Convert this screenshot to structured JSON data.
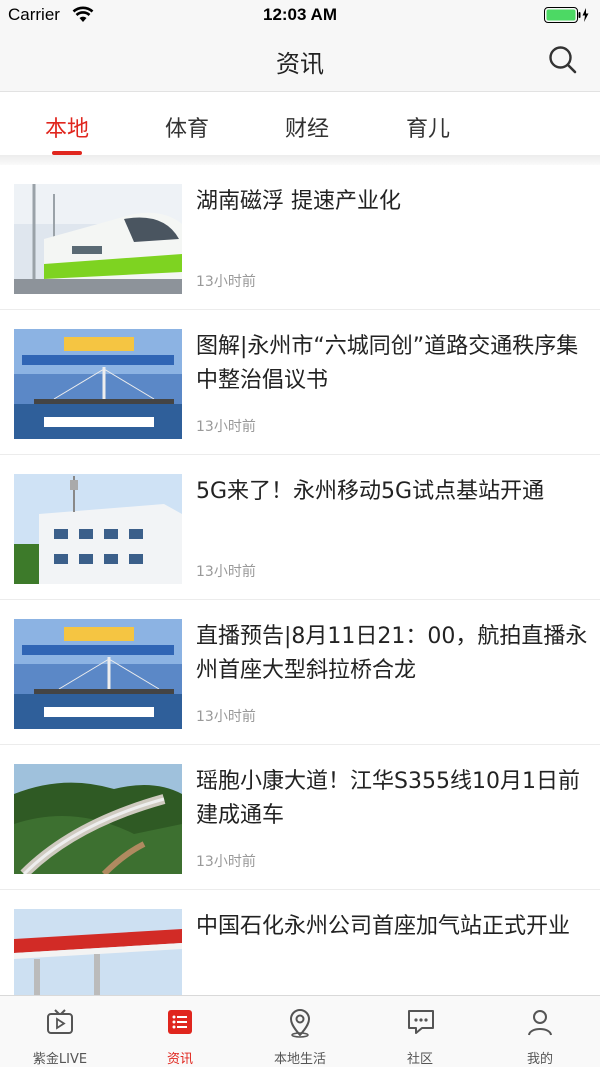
{
  "status_bar": {
    "carrier": "Carrier",
    "time": "12:03 AM"
  },
  "nav": {
    "title": "资讯"
  },
  "tabs": [
    {
      "label": "本地",
      "active": true
    },
    {
      "label": "体育",
      "active": false
    },
    {
      "label": "财经",
      "active": false
    },
    {
      "label": "育儿",
      "active": false
    }
  ],
  "news": [
    {
      "title": "湖南磁浮 提速产业化",
      "time": "13小时前"
    },
    {
      "title": "图解|永州市“六城同创”道路交通秩序集中整治倡议书",
      "time": "13小时前"
    },
    {
      "title": "5G来了！永州移动5G试点基站开通",
      "time": "13小时前"
    },
    {
      "title": "直播预告|8月11日21：00，航拍直播永州首座大型斜拉桥合龙",
      "time": "13小时前"
    },
    {
      "title": "瑶胞小康大道！江华S355线10月1日前建成通车",
      "time": "13小时前"
    },
    {
      "title": "中国石化永州公司首座加气站正式开业",
      "time": ""
    }
  ],
  "tab_bar": [
    {
      "label": "紫金LIVE",
      "icon": "tv-icon",
      "active": false
    },
    {
      "label": "资讯",
      "icon": "news-icon",
      "active": true
    },
    {
      "label": "本地生活",
      "icon": "location-icon",
      "active": false
    },
    {
      "label": "社区",
      "icon": "chat-icon",
      "active": false
    },
    {
      "label": "我的",
      "icon": "person-icon",
      "active": false
    }
  ],
  "colors": {
    "accent": "#e0261e",
    "nav_bg": "#f7f7f7",
    "muted_text": "#999999"
  }
}
